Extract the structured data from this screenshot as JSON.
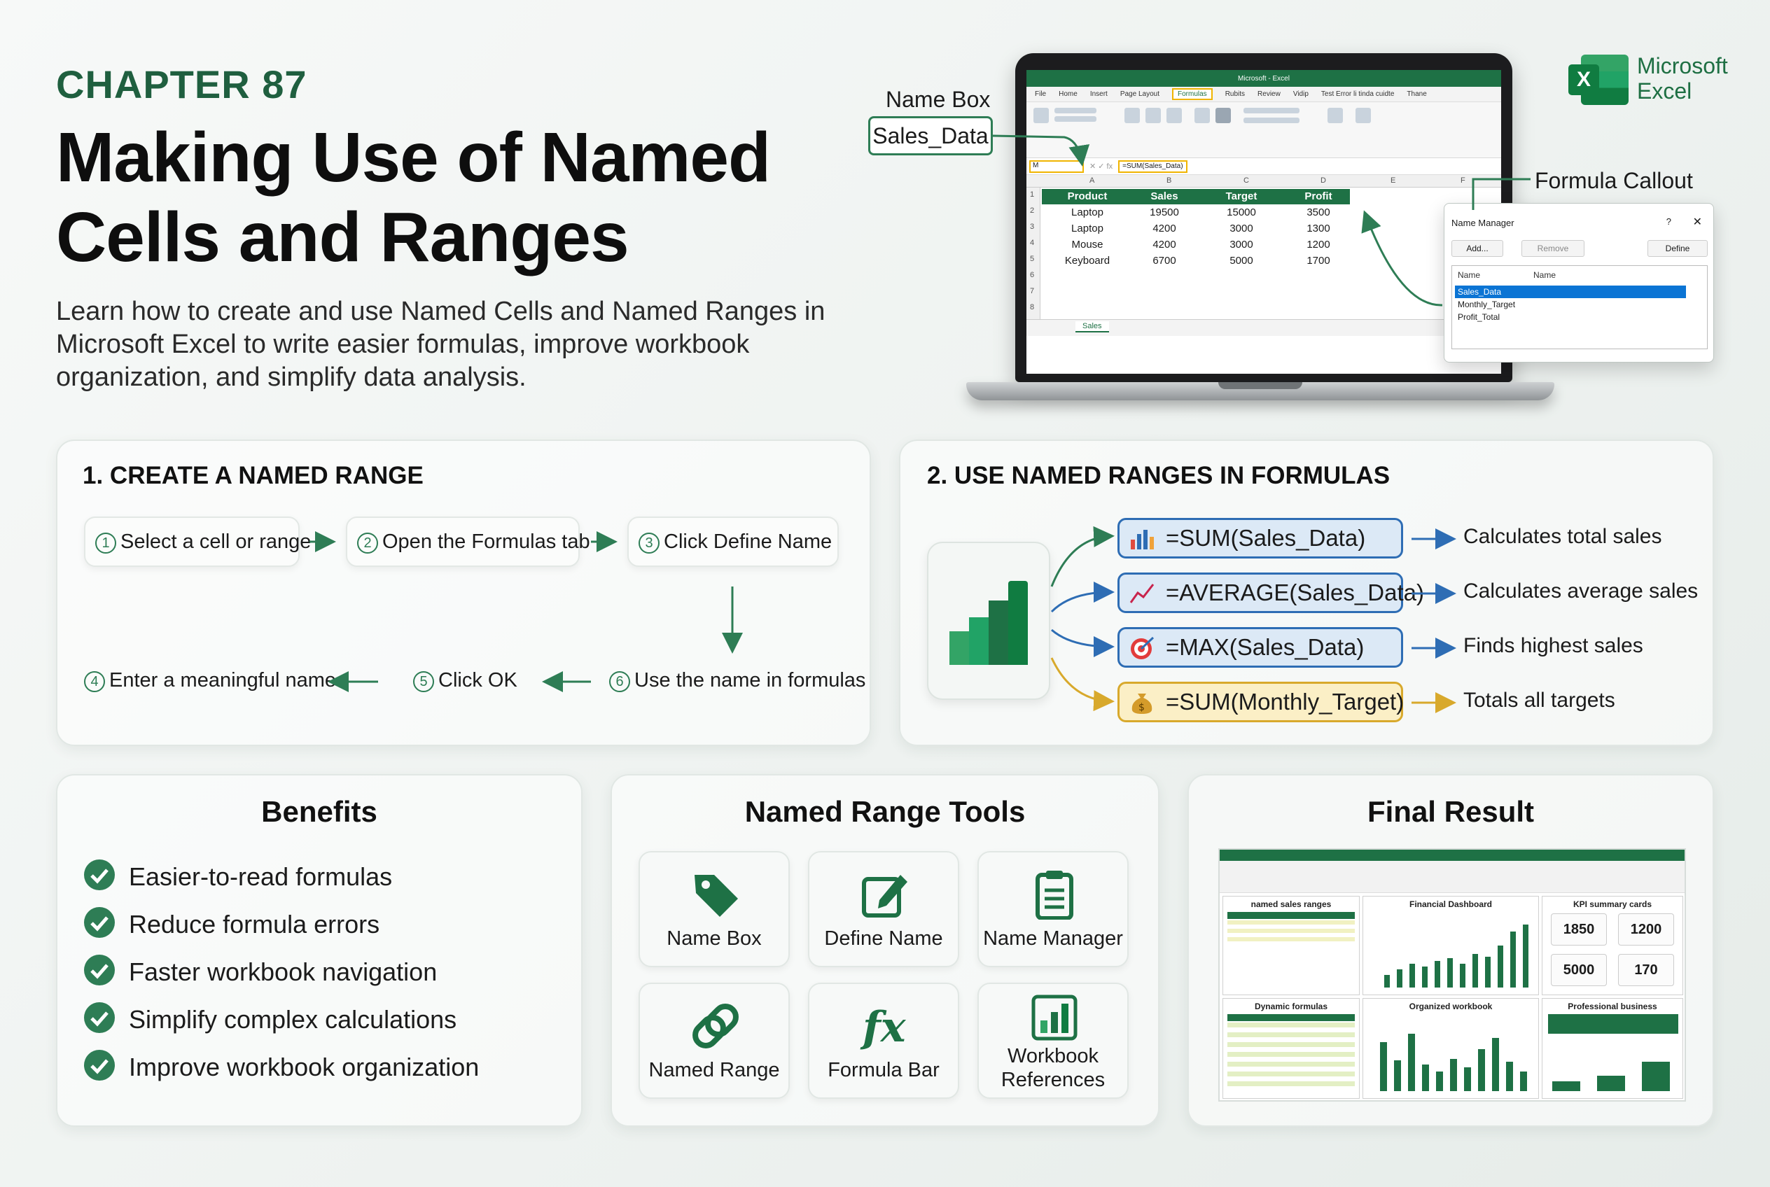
{
  "header": {
    "chapter": "CHAPTER 87",
    "title": "Making Use of Named Cells and Ranges",
    "subtitle": "Learn how to create and use Named Cells and Named Ranges in Microsoft Excel to write easier formulas, improve workbook organization, and simplify data analysis."
  },
  "brand": {
    "line1": "Microsoft",
    "line2": "Excel",
    "icon_letter": "X"
  },
  "callouts": {
    "name_box_label": "Name Box",
    "name_box_value": "Sales_Data",
    "formula_callout": "Formula Callout"
  },
  "excel": {
    "window_title": "Microsoft - Excel",
    "menu": [
      "File",
      "Home",
      "Insert",
      "Page Layout",
      "Formulas",
      "Rubits",
      "Review",
      "Vidip",
      "Test Error li tinda cuidte",
      "Thane"
    ],
    "name_box": "M",
    "formula": "=SUM(Sales_Data)",
    "columns": [
      "A",
      "B",
      "C",
      "D",
      "E",
      "F"
    ],
    "rows": [
      "1",
      "2",
      "3",
      "4",
      "5",
      "6",
      "7",
      "8"
    ],
    "headers": [
      "Product",
      "Sales",
      "Target",
      "Profit"
    ],
    "table": [
      [
        "Laptop",
        "19500",
        "15000",
        "3500"
      ],
      [
        "Laptop",
        "4200",
        "3000",
        "1300"
      ],
      [
        "Mouse",
        "4200",
        "3000",
        "1200"
      ],
      [
        "Keyboard",
        "6700",
        "5000",
        "1700"
      ]
    ],
    "sheet_tab": "Sales"
  },
  "name_manager": {
    "title": "Name Manager",
    "help": "?",
    "close": "✕",
    "buttons": [
      "Add...",
      "Remove",
      "Define"
    ],
    "columns": [
      "Name",
      "Name"
    ],
    "names": [
      "Sales_Data",
      "Monthly_Target",
      "Profit_Total"
    ]
  },
  "panel_create": {
    "heading": "1. CREATE A NAMED RANGE",
    "steps": [
      {
        "num": "1",
        "text": "Select a cell or range"
      },
      {
        "num": "2",
        "text": "Open the Formulas tab"
      },
      {
        "num": "3",
        "text": "Click Define Name"
      },
      {
        "num": "4",
        "text": "Enter a meaningful name"
      },
      {
        "num": "5",
        "text": "Click OK"
      },
      {
        "num": "6",
        "text": "Use the name in formulas"
      }
    ]
  },
  "panel_formulas": {
    "heading": "2. USE NAMED RANGES IN FORMULAS",
    "items": [
      {
        "formula": "=SUM(Sales_Data)",
        "desc": "Calculates total sales",
        "icon": "bar-chart-icon"
      },
      {
        "formula": "=AVERAGE(Sales_Data)",
        "desc": "Calculates average sales",
        "icon": "trend-line-icon"
      },
      {
        "formula": "=MAX(Sales_Data)",
        "desc": "Finds highest sales",
        "icon": "target-icon"
      },
      {
        "formula": "=SUM(Monthly_Target)",
        "desc": "Totals all targets",
        "icon": "money-bag-icon"
      }
    ]
  },
  "benefits": {
    "heading": "Benefits",
    "items": [
      "Easier-to-read formulas",
      "Reduce formula errors",
      "Faster workbook navigation",
      "Simplify complex calculations",
      "Improve workbook organization"
    ]
  },
  "tools": {
    "heading": "Named Range Tools",
    "items": [
      {
        "label": "Name Box",
        "icon": "tag-icon"
      },
      {
        "label": "Define Name",
        "icon": "edit-icon"
      },
      {
        "label": "Name Manager",
        "icon": "clipboard-icon"
      },
      {
        "label": "Named Range",
        "icon": "link-icon"
      },
      {
        "label": "Formula Bar",
        "icon": "fx-icon"
      },
      {
        "label": "Workbook References",
        "icon": "chart-icon"
      }
    ]
  },
  "final": {
    "heading": "Final Result",
    "cards": [
      "named sales ranges",
      "Financial Dashboard",
      "KPI summary cards",
      "Dynamic formulas",
      "Organized workbook",
      "Professional business"
    ],
    "kpis": [
      "1850",
      "1200",
      "5000",
      "170"
    ]
  },
  "colors": {
    "brand_green": "#1e7145",
    "accent_blue": "#2e6db4",
    "accent_gold": "#d8a92c",
    "heading_green": "#1f5f3f"
  }
}
